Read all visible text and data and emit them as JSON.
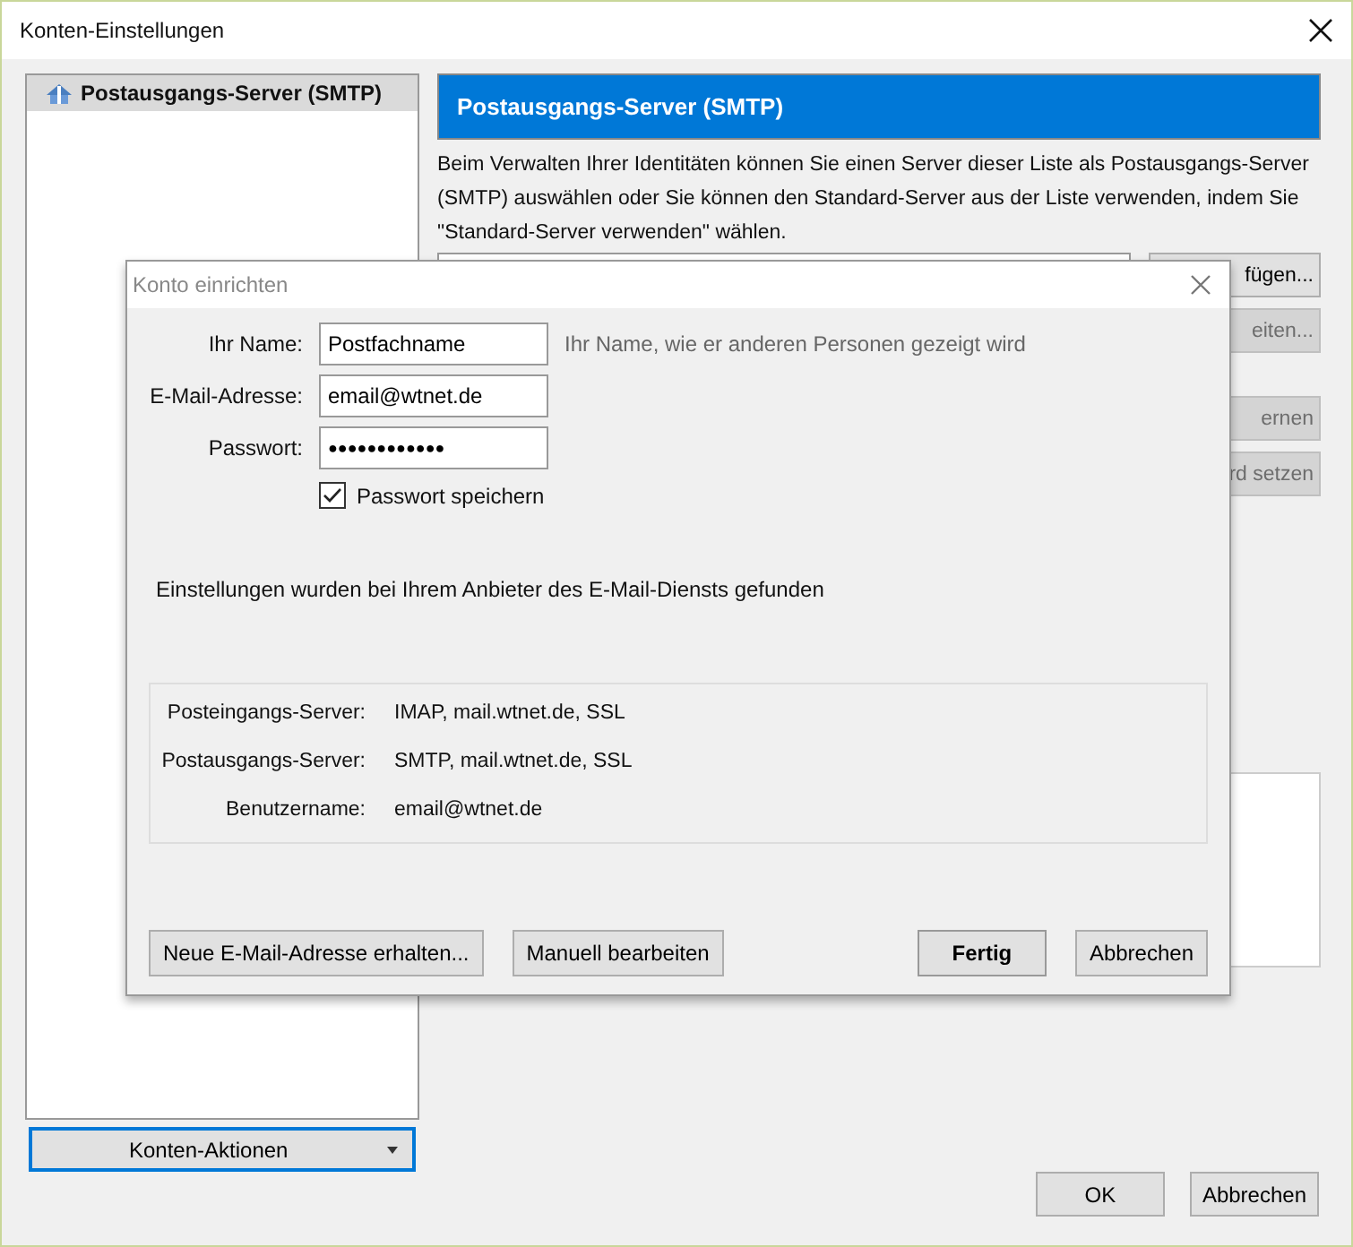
{
  "window": {
    "title": "Konten-Einstellungen"
  },
  "sidebar": {
    "items": [
      {
        "label": "Postausgangs-Server (SMTP)",
        "selected": true
      }
    ],
    "actions_button": "Konten-Aktionen"
  },
  "panel": {
    "header": "Postausgangs-Server (SMTP)",
    "description": "Beim Verwalten Ihrer Identitäten können Sie einen Server dieser Liste als Postausgangs-Server (SMTP) auswählen oder Sie können den Standard-Server aus der Liste verwenden, indem Sie \"Standard-Server verwenden\" wählen.",
    "side_buttons": [
      {
        "label": "fügen...",
        "disabled": false
      },
      {
        "label": "eiten...",
        "disabled": true
      },
      {
        "label": "ernen",
        "disabled": true
      },
      {
        "label": "rd setzen",
        "disabled": true
      }
    ]
  },
  "footer_buttons": [
    "OK",
    "Abbrechen"
  ],
  "dialog": {
    "title": "Konto einrichten",
    "fields": [
      {
        "label": "Ihr Name:",
        "value": "Postfachname",
        "hint": "Ihr Name, wie er anderen Personen gezeigt wird",
        "kind": "text"
      },
      {
        "label": "E-Mail-Adresse:",
        "value": "email@wtnet.de",
        "kind": "text"
      },
      {
        "label": "Passwort:",
        "value": "●●●●●●●●●●●●",
        "kind": "password"
      }
    ],
    "remember": {
      "label": "Passwort speichern",
      "checked": true
    },
    "message": "Einstellungen wurden bei Ihrem Anbieter des E-Mail-Diensts gefunden",
    "summary": [
      {
        "label": "Posteingangs-Server:",
        "value": "IMAP, mail.wtnet.de, SSL"
      },
      {
        "label": "Postausgangs-Server:",
        "value": "SMTP, mail.wtnet.de, SSL"
      },
      {
        "label": "Benutzername:",
        "value": "email@wtnet.de"
      }
    ],
    "buttons": [
      {
        "label": "Neue E-Mail-Adresse erhalten...",
        "default": false
      },
      {
        "label": "Manuell bearbeiten",
        "default": false
      },
      {
        "label": "Fertig",
        "default": true
      },
      {
        "label": "Abbrechen",
        "default": false
      }
    ]
  }
}
